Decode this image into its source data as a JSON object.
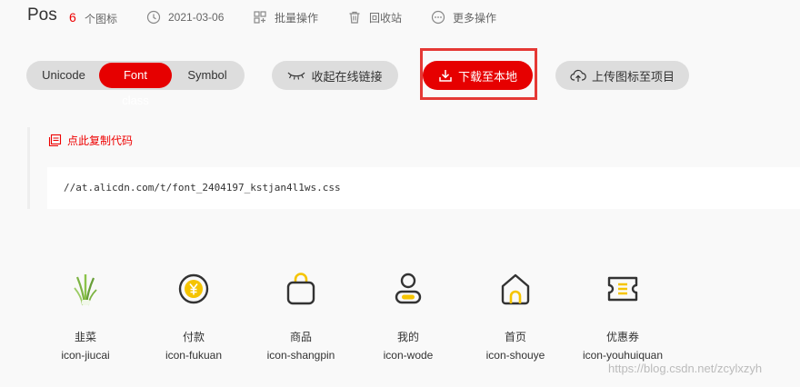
{
  "header": {
    "project_title": "Pos",
    "icon_count": "6",
    "icon_count_label": "个图标",
    "date": "2021-03-06",
    "batch_label": "批量操作",
    "recycle_label": "回收站",
    "more_label": "更多操作"
  },
  "toolbar": {
    "tabs": [
      "Unicode",
      "Font class",
      "Symbol"
    ],
    "active_tab": "Font class",
    "collapse_label": "收起在线链接",
    "download_label": "下载至本地",
    "upload_label": "上传图标至项目"
  },
  "code": {
    "copy_label": "点此复制代码",
    "url": "//at.alicdn.com/t/font_2404197_kstjan4l1ws.css"
  },
  "icons": [
    {
      "name": "韭菜",
      "class": "icon-jiucai",
      "icon": "chive-icon"
    },
    {
      "name": "付款",
      "class": "icon-fukuan",
      "icon": "yen-coin-icon"
    },
    {
      "name": "商品",
      "class": "icon-shangpin",
      "icon": "shopping-bag-icon"
    },
    {
      "name": "我的",
      "class": "icon-wode",
      "icon": "user-icon"
    },
    {
      "name": "首页",
      "class": "icon-shouye",
      "icon": "home-icon"
    },
    {
      "name": "优惠券",
      "class": "icon-youhuiquan",
      "icon": "coupon-icon"
    }
  ],
  "watermark": "https://blog.csdn.net/zcylxzyh",
  "colors": {
    "accent": "#e60000",
    "icon_stroke": "#333333",
    "icon_highlight": "#f5c400",
    "chive_green": "#7cb342"
  }
}
